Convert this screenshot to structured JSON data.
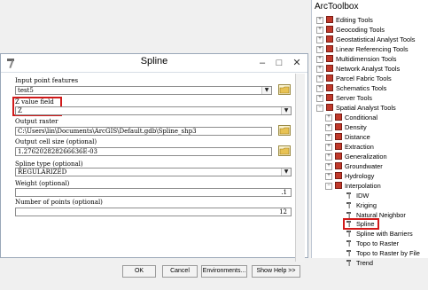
{
  "dialog": {
    "title": "Spline",
    "input_label": "Input point features",
    "input_value": "test5",
    "zfield_label": "Z value field",
    "zfield_value": "Z",
    "output_label": "Output raster",
    "output_value": "C:\\Users\\lin\\Documents\\ArcGIS\\Default.gdb\\Spline_shp3",
    "cellsize_label": "Output cell size (optional)",
    "cellsize_value": "1.276202828266636E-03",
    "splinetype_label": "Spline type (optional)",
    "splinetype_value": "REGULARIZED",
    "weight_label": "Weight (optional)",
    "weight_value": ".1",
    "points_label": "Number of points (optional)",
    "points_value": "12",
    "buttons": {
      "ok": "OK",
      "cancel": "Cancel",
      "environments": "Environments...",
      "showhelp": "Show Help >>"
    },
    "window_controls": {
      "minimize": "–",
      "maximize": "□",
      "close": "✕"
    }
  },
  "toolbox": {
    "title": "ArcToolbox",
    "items": [
      {
        "label": "Editing Tools"
      },
      {
        "label": "Geocoding Tools"
      },
      {
        "label": "Geostatistical Analyst Tools"
      },
      {
        "label": "Linear Referencing Tools"
      },
      {
        "label": "Multidimension Tools"
      },
      {
        "label": "Network Analyst Tools"
      },
      {
        "label": "Parcel Fabric Tools"
      },
      {
        "label": "Schematics Tools"
      },
      {
        "label": "Server Tools"
      },
      {
        "label": "Spatial Analyst Tools"
      }
    ],
    "spatial_children": [
      {
        "label": "Conditional"
      },
      {
        "label": "Density"
      },
      {
        "label": "Distance"
      },
      {
        "label": "Extraction"
      },
      {
        "label": "Generalization"
      },
      {
        "label": "Groundwater"
      },
      {
        "label": "Hydrology"
      },
      {
        "label": "Interpolation"
      }
    ],
    "interp_tools": [
      {
        "label": "IDW"
      },
      {
        "label": "Kriging"
      },
      {
        "label": "Natural Neighbor"
      },
      {
        "label": "Spline"
      },
      {
        "label": "Spline with Barriers"
      },
      {
        "label": "Topo to Raster"
      },
      {
        "label": "Topo to Raster by File"
      },
      {
        "label": "Trend"
      }
    ]
  },
  "colors": {
    "highlight": "#d11a1a",
    "toolbox_red": "#c0392b"
  }
}
